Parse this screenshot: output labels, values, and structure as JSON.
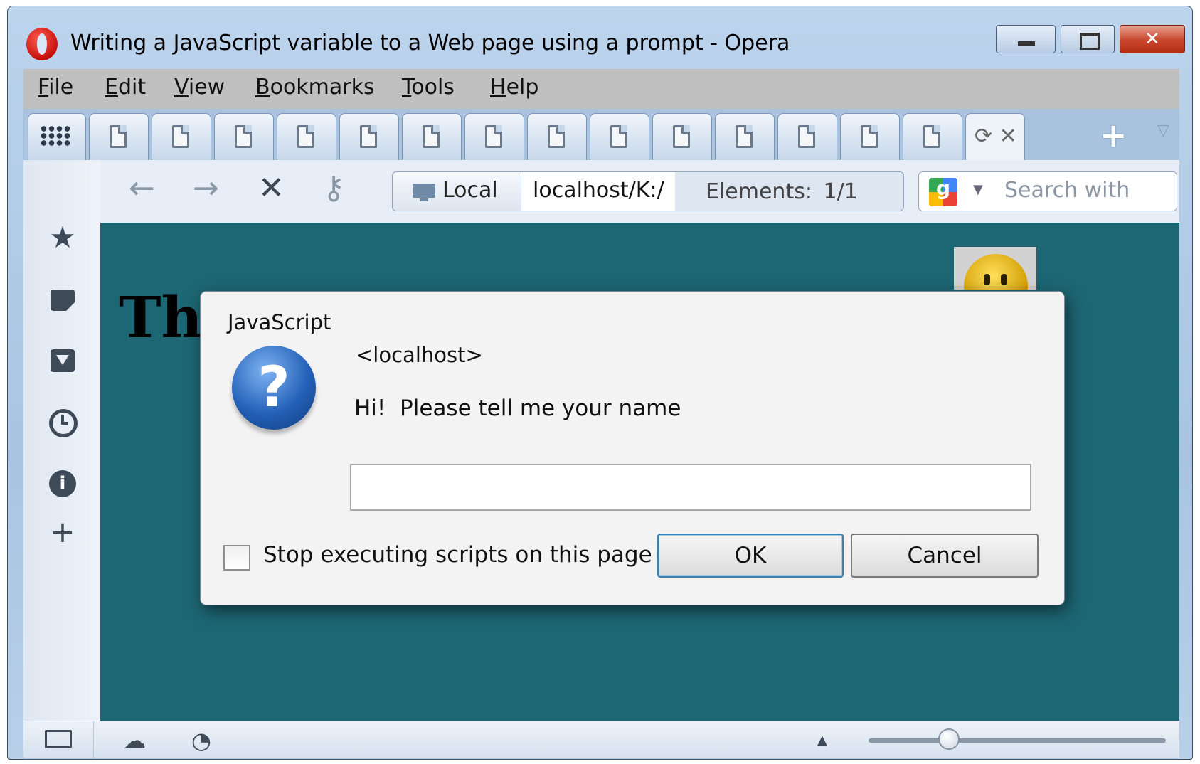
{
  "window": {
    "title": "Writing a JavaScript variable to a Web page using a prompt - Opera",
    "controls": {
      "minimize": "minimize",
      "maximize": "maximize",
      "close": "✕"
    }
  },
  "menu": {
    "items": [
      {
        "label": "File",
        "accel": "F",
        "rest": "ile"
      },
      {
        "label": "Edit",
        "accel": "E",
        "rest": "dit"
      },
      {
        "label": "View",
        "accel": "V",
        "rest": "iew"
      },
      {
        "label": "Bookmarks",
        "accel": "B",
        "rest": "ookmarks"
      },
      {
        "label": "Tools",
        "accel": "T",
        "rest": "ools"
      },
      {
        "label": "Help",
        "accel": "H",
        "rest": "elp"
      }
    ]
  },
  "tabs": {
    "count_inactive": 14,
    "active_icons": "⟳ ✕",
    "new_tab": "+",
    "tab_list": "▽"
  },
  "toolbar": {
    "back_icon": "←",
    "forward_icon": "→",
    "stop_icon": "✕",
    "wand_icon": "⚷",
    "site_badge": "Local",
    "url": "localhost/K:/",
    "elements_text": "Elements:  1/1",
    "search_placeholder": "Search with"
  },
  "sidepanel": {
    "icons": [
      "bookmarks-icon",
      "notes-icon",
      "downloads-icon",
      "history-icon",
      "info-icon",
      "add-panel-icon"
    ]
  },
  "page": {
    "heading": "Th"
  },
  "dialog": {
    "title": "JavaScript",
    "origin": "<localhost>",
    "message": "Hi!  Please tell me your name",
    "input_value": "",
    "checkbox_label": "Stop executing scripts on this page",
    "checkbox_checked": false,
    "ok_label": "OK",
    "cancel_label": "Cancel"
  },
  "statusbar": {
    "zoom_fraction": 0.27
  },
  "colors": {
    "page_background": "#1d6673",
    "dialog_background": "#f3f3f3",
    "menubar": "#c0c0c0"
  }
}
